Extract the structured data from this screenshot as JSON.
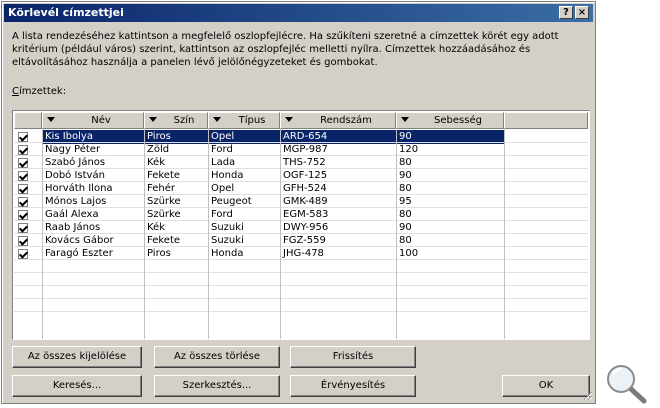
{
  "dialog": {
    "title": "Körlevél címzettjei",
    "help_button": "?",
    "close_button": "×",
    "description": "A lista rendezéséhez kattintson a megfelelő oszlopfejlécre. Ha szűkíteni szeretné a címzettek körét egy adott kritérium (például város) szerint, kattintson az oszlopfejléc melletti nyílra. Címzettek hozzáadásához és eltávolításához használja a panelen lévő jelölőnégyzeteket és gombokat.",
    "list_label_accel": "C",
    "list_label_rest": "ímzettek:"
  },
  "grid": {
    "columns": [
      "Név",
      "Szín",
      "Típus",
      "Rendszám",
      "Sebesség"
    ],
    "rows": [
      {
        "checked": true,
        "cells": [
          "Kis Ibolya",
          "Piros",
          "Opel",
          "ARD-654",
          "90"
        ],
        "selected": true
      },
      {
        "checked": true,
        "cells": [
          "Nagy Péter",
          "Zöld",
          "Ford",
          "MGP-987",
          "120"
        ]
      },
      {
        "checked": true,
        "cells": [
          "Szabó János",
          "Kék",
          "Lada",
          "THS-752",
          "80"
        ]
      },
      {
        "checked": true,
        "cells": [
          "Dobó István",
          "Fekete",
          "Honda",
          "OGF-125",
          "90"
        ]
      },
      {
        "checked": true,
        "cells": [
          "Horváth Ilona",
          "Fehér",
          "Opel",
          "GFH-524",
          "80"
        ]
      },
      {
        "checked": true,
        "cells": [
          "Mónos Lajos",
          "Szürke",
          "Peugeot",
          "GMK-489",
          "95"
        ]
      },
      {
        "checked": true,
        "cells": [
          "Gaál Alexa",
          "Szürke",
          "Ford",
          "EGM-583",
          "80"
        ]
      },
      {
        "checked": true,
        "cells": [
          "Raab János",
          "Kék",
          "Suzuki",
          "DWY-956",
          "90"
        ]
      },
      {
        "checked": true,
        "cells": [
          "Kovács Gábor",
          "Fekete",
          "Suzuki",
          "FGZ-559",
          "80"
        ]
      },
      {
        "checked": true,
        "cells": [
          "Faragó Eszter",
          "Piros",
          "Honda",
          "JHG-478",
          "100"
        ]
      }
    ]
  },
  "buttons": {
    "select_all": "Az összes kijelölése",
    "clear_all": "Az összes törlése",
    "refresh": "Frissítés",
    "find": "Keresés...",
    "edit": "Szerkesztés...",
    "validate": "Érvényesítés",
    "ok": "OK"
  },
  "colors": {
    "title_bar": "#0a246a",
    "selection": "#0a246a",
    "dialog_bg": "#d4d0c8"
  }
}
